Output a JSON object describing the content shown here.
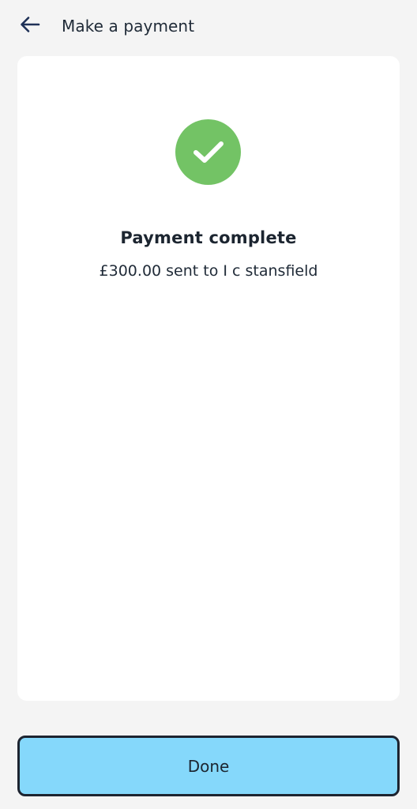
{
  "header": {
    "back_icon": "arrow-left-icon",
    "title": "Make a payment"
  },
  "result": {
    "icon": "check-circle-icon",
    "icon_color": "#73c365",
    "title": "Payment complete",
    "detail": "£300.00 sent to I c stansfield"
  },
  "actions": {
    "done_label": "Done",
    "done_color": "#85d8fb"
  }
}
